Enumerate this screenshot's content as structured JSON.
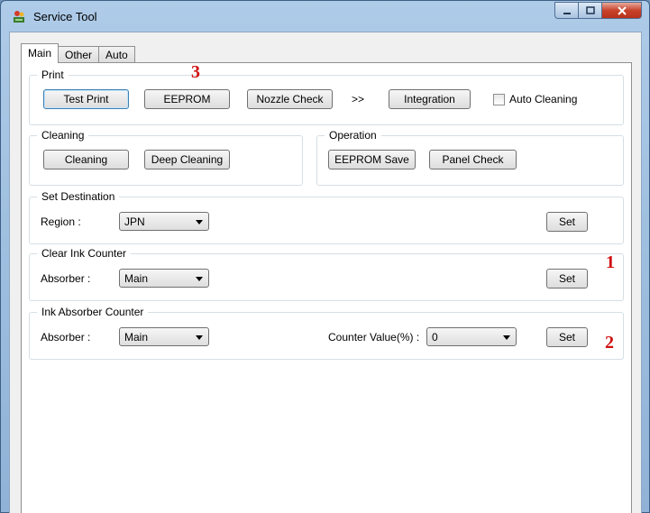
{
  "window": {
    "title": "Service Tool",
    "icon": "service-tool-app-icon"
  },
  "tabs": [
    {
      "label": "Main",
      "active": true
    },
    {
      "label": "Other"
    },
    {
      "label": "Auto"
    }
  ],
  "print": {
    "legend": "Print",
    "test_print": "Test Print",
    "eeprom": "EEPROM",
    "nozzle_check": "Nozzle Check",
    "arrow": ">>",
    "integration": "Integration",
    "auto_cleaning": "Auto Cleaning"
  },
  "cleaning": {
    "legend": "Cleaning",
    "cleaning": "Cleaning",
    "deep_cleaning": "Deep Cleaning"
  },
  "operation": {
    "legend": "Operation",
    "eeprom_save": "EEPROM Save",
    "panel_check": "Panel Check"
  },
  "set_destination": {
    "legend": "Set Destination",
    "region_label": "Region :",
    "region_value": "JPN",
    "set": "Set"
  },
  "clear_ink_counter": {
    "legend": "Clear Ink Counter",
    "absorber_label": "Absorber :",
    "absorber_value": "Main",
    "set": "Set"
  },
  "ink_absorber_counter": {
    "legend": "Ink Absorber Counter",
    "absorber_label": "Absorber :",
    "absorber_value": "Main",
    "counter_label": "Counter Value(%) :",
    "counter_value": "0",
    "set": "Set"
  },
  "markers": {
    "m1": "1",
    "m2": "2",
    "m3": "3"
  },
  "colors": {
    "marker": "#d01010",
    "title_bar": "#aecbe8"
  }
}
